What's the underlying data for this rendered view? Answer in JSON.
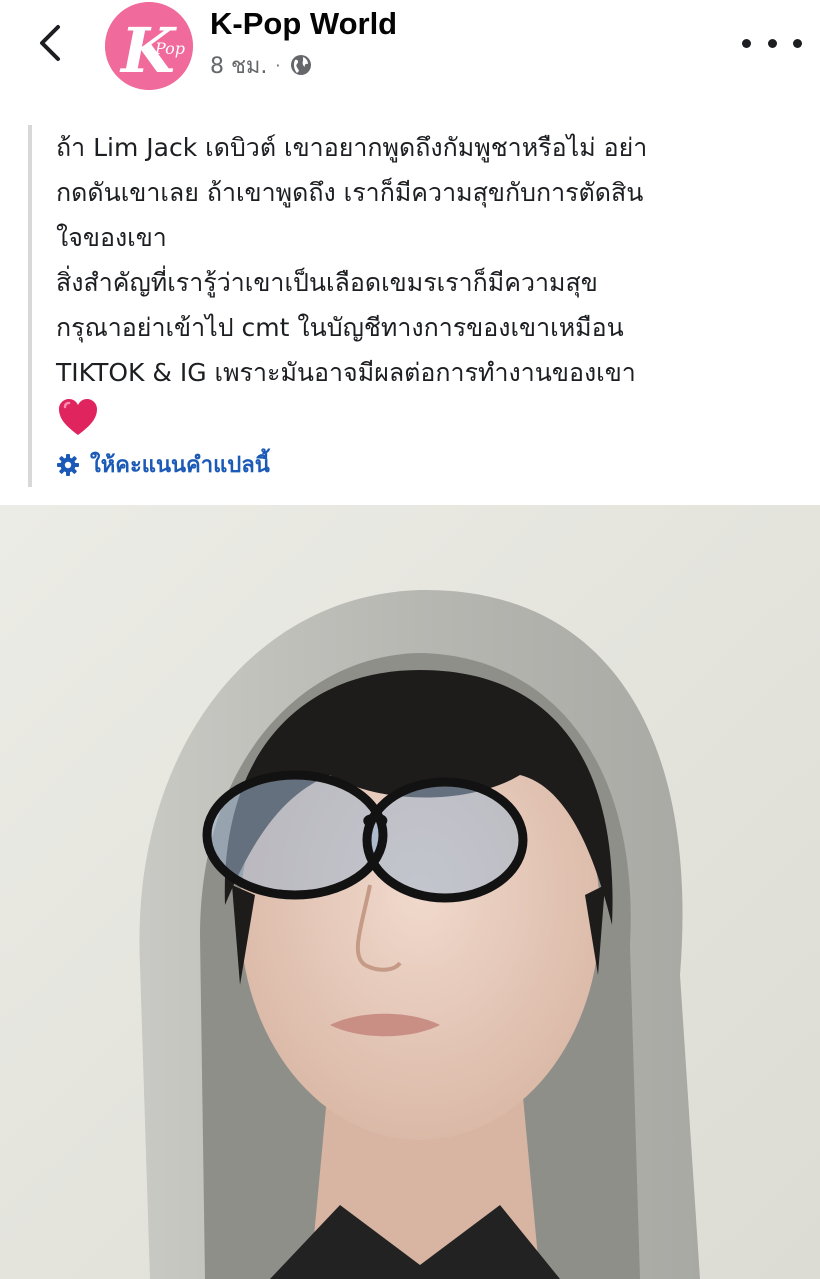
{
  "header": {
    "page_name": "K-Pop World",
    "time": "8 ชม.",
    "separator": "·",
    "avatar_letter": "K",
    "avatar_text": "Pop"
  },
  "post": {
    "text": "ถ้า Lim Jack เดบิวต์ เขาอยากพูดถึงกัมพูชาหรือไม่ อย่า\nกดดันเขาเลย ถ้าเขาพูดถึง เราก็มีความสุขกับการตัดสิน\nใจของเขา\nสิ่งสำคัญที่เรารู้ว่าเขาเป็นเลือดเขมรเราก็มีความสุข\nกรุณาอย่าเข้าไป cmt ในบัญชีทางการของเขาเหมือน\nTIKTOK & IG เพราะมันอาจมีผลต่อการทำงานของเขา",
    "rate_translation": "ให้คะแนนคำแปลนี้"
  },
  "colors": {
    "avatar_bg": "#f06a9c",
    "link": "#1b5ab6",
    "heart": "#e0245e"
  },
  "icons": [
    "back-arrow-icon",
    "globe-icon",
    "more-dots-icon",
    "heart-icon",
    "gear-icon"
  ]
}
